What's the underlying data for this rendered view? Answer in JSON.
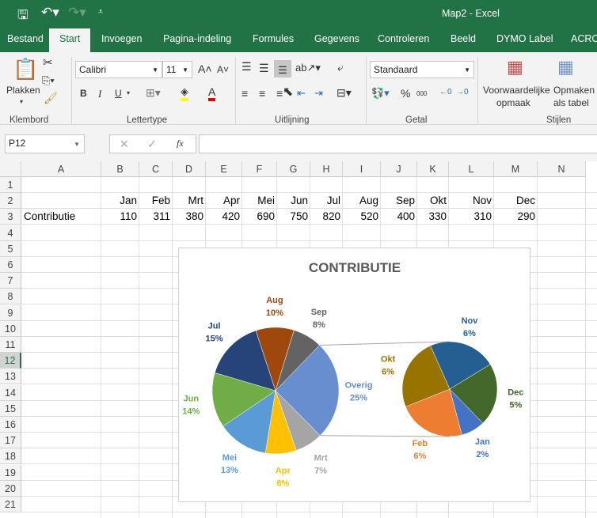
{
  "titlebar": {
    "title": "Map2  -  Excel"
  },
  "tabs": [
    "Bestand",
    "Start",
    "Invoegen",
    "Pagina-indeling",
    "Formules",
    "Gegevens",
    "Controleren",
    "Beeld",
    "DYMO Label",
    "ACRO"
  ],
  "ribbon": {
    "paste_label": "Plakken",
    "font_name": "Calibri",
    "font_size": "11",
    "number_format": "Standaard",
    "cond_format_label1": "Voorwaardelijke",
    "cond_format_label2": "opmaak",
    "table_format_label1": "Opmaken",
    "table_format_label2": "als tabel",
    "groups": [
      "Klembord",
      "Lettertype",
      "Uitlijning",
      "Getal",
      "Stijlen"
    ],
    "bold": "B",
    "italic": "I",
    "underline": "U",
    "percent": "%",
    "thousands": "000"
  },
  "formula_bar": {
    "name_box": "P12",
    "fx": "fx",
    "value": ""
  },
  "columns": [
    "A",
    "B",
    "C",
    "D",
    "E",
    "F",
    "G",
    "H",
    "I",
    "J",
    "K",
    "L",
    "M",
    "N"
  ],
  "rows": [
    "1",
    "2",
    "3",
    "4",
    "5",
    "6",
    "7",
    "8",
    "9",
    "10",
    "11",
    "12",
    "13",
    "14",
    "15",
    "16",
    "17",
    "18",
    "19",
    "20",
    "21"
  ],
  "selected_row": "12",
  "sheet": {
    "header_row": [
      "",
      "Jan",
      "Feb",
      "Mrt",
      "Apr",
      "Mei",
      "Jun",
      "Jul",
      "Aug",
      "Sep",
      "Okt",
      "Nov",
      "Dec"
    ],
    "data_row": [
      "Contributie",
      "110",
      "311",
      "380",
      "420",
      "690",
      "750",
      "820",
      "520",
      "400",
      "330",
      "310",
      "290"
    ]
  },
  "chart_data": {
    "type": "pie",
    "subtype": "pie-of-pie",
    "title": "CONTRIBUTIE",
    "main": [
      {
        "label": "Overig",
        "value": 1351,
        "pct": "25%",
        "color": "#698ED0"
      },
      {
        "label": "Mrt",
        "value": 380,
        "pct": "7%",
        "color": "#A5A5A5"
      },
      {
        "label": "Apr",
        "value": 420,
        "pct": "8%",
        "color": "#FFC000"
      },
      {
        "label": "Mei",
        "value": 690,
        "pct": "13%",
        "color": "#5B9BD5"
      },
      {
        "label": "Jun",
        "value": 750,
        "pct": "14%",
        "color": "#70AD47"
      },
      {
        "label": "Jul",
        "value": 820,
        "pct": "15%",
        "color": "#264478"
      },
      {
        "label": "Aug",
        "value": 520,
        "pct": "10%",
        "color": "#9E480E"
      },
      {
        "label": "Sep",
        "value": 400,
        "pct": "8%",
        "color": "#636363"
      }
    ],
    "secondary": [
      {
        "label": "Nov",
        "value": 310,
        "pct": "6%",
        "color": "#255E91"
      },
      {
        "label": "Dec",
        "value": 290,
        "pct": "5%",
        "color": "#43682B"
      },
      {
        "label": "Jan",
        "value": 110,
        "pct": "2%",
        "color": "#4472C4"
      },
      {
        "label": "Feb",
        "value": 311,
        "pct": "6%",
        "color": "#ED7D31"
      },
      {
        "label": "Okt",
        "value": 330,
        "pct": "6%",
        "color": "#997300"
      }
    ]
  }
}
